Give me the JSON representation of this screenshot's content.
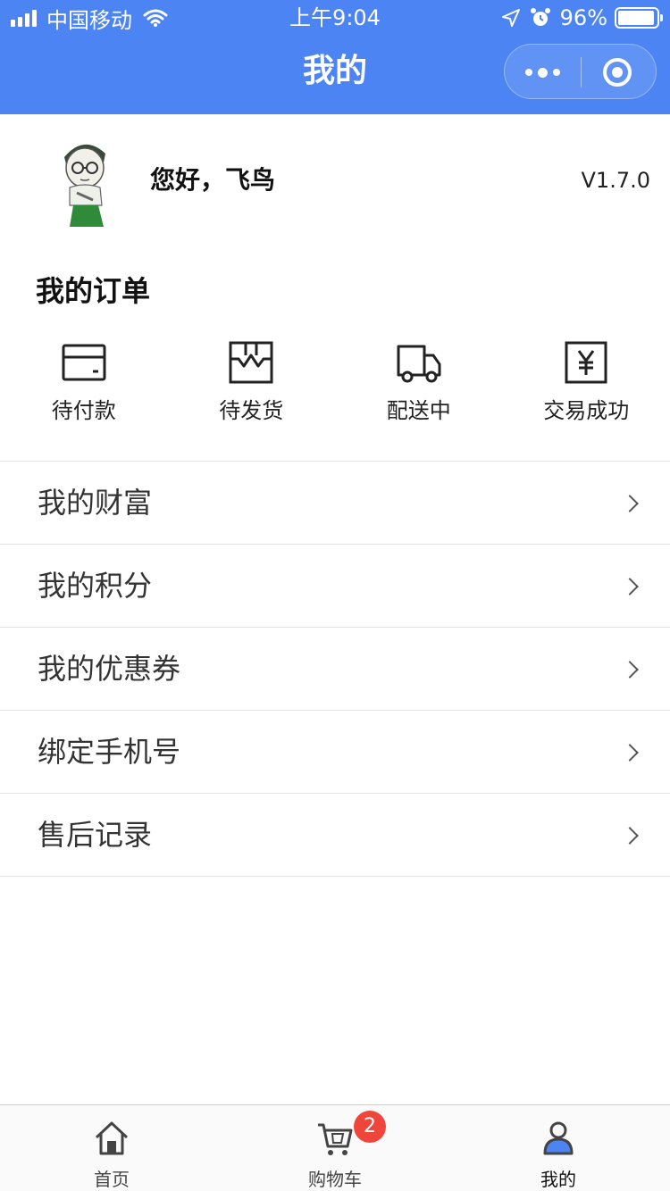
{
  "status_bar": {
    "carrier": "中国移动",
    "time": "上午9:04",
    "battery": "96%",
    "battery_level": 0.96
  },
  "nav": {
    "title": "我的",
    "more_icon": "more-dots-icon",
    "close_icon": "target-circle-icon"
  },
  "colors": {
    "header_bg": "#4c84f3",
    "badge_bg": "#f0453a",
    "active_tab": "#4c84f3"
  },
  "profile": {
    "greeting": "您好，飞鸟",
    "version": "V1.7.0"
  },
  "orders": {
    "title": "我的订单",
    "items": [
      {
        "label": "待付款",
        "icon": "wallet-icon"
      },
      {
        "label": "待发货",
        "icon": "package-box-icon"
      },
      {
        "label": "配送中",
        "icon": "delivery-truck-icon"
      },
      {
        "label": "交易成功",
        "icon": "yuan-receipt-icon"
      }
    ]
  },
  "menu": {
    "items": [
      {
        "label": "我的财富"
      },
      {
        "label": "我的积分"
      },
      {
        "label": "我的优惠券"
      },
      {
        "label": "绑定手机号"
      },
      {
        "label": "售后记录"
      }
    ]
  },
  "tabbar": {
    "tabs": [
      {
        "label": "首页",
        "icon": "home-icon"
      },
      {
        "label": "购物车",
        "icon": "cart-icon",
        "badge": "2"
      },
      {
        "label": "我的",
        "icon": "user-icon",
        "active": true
      }
    ]
  }
}
